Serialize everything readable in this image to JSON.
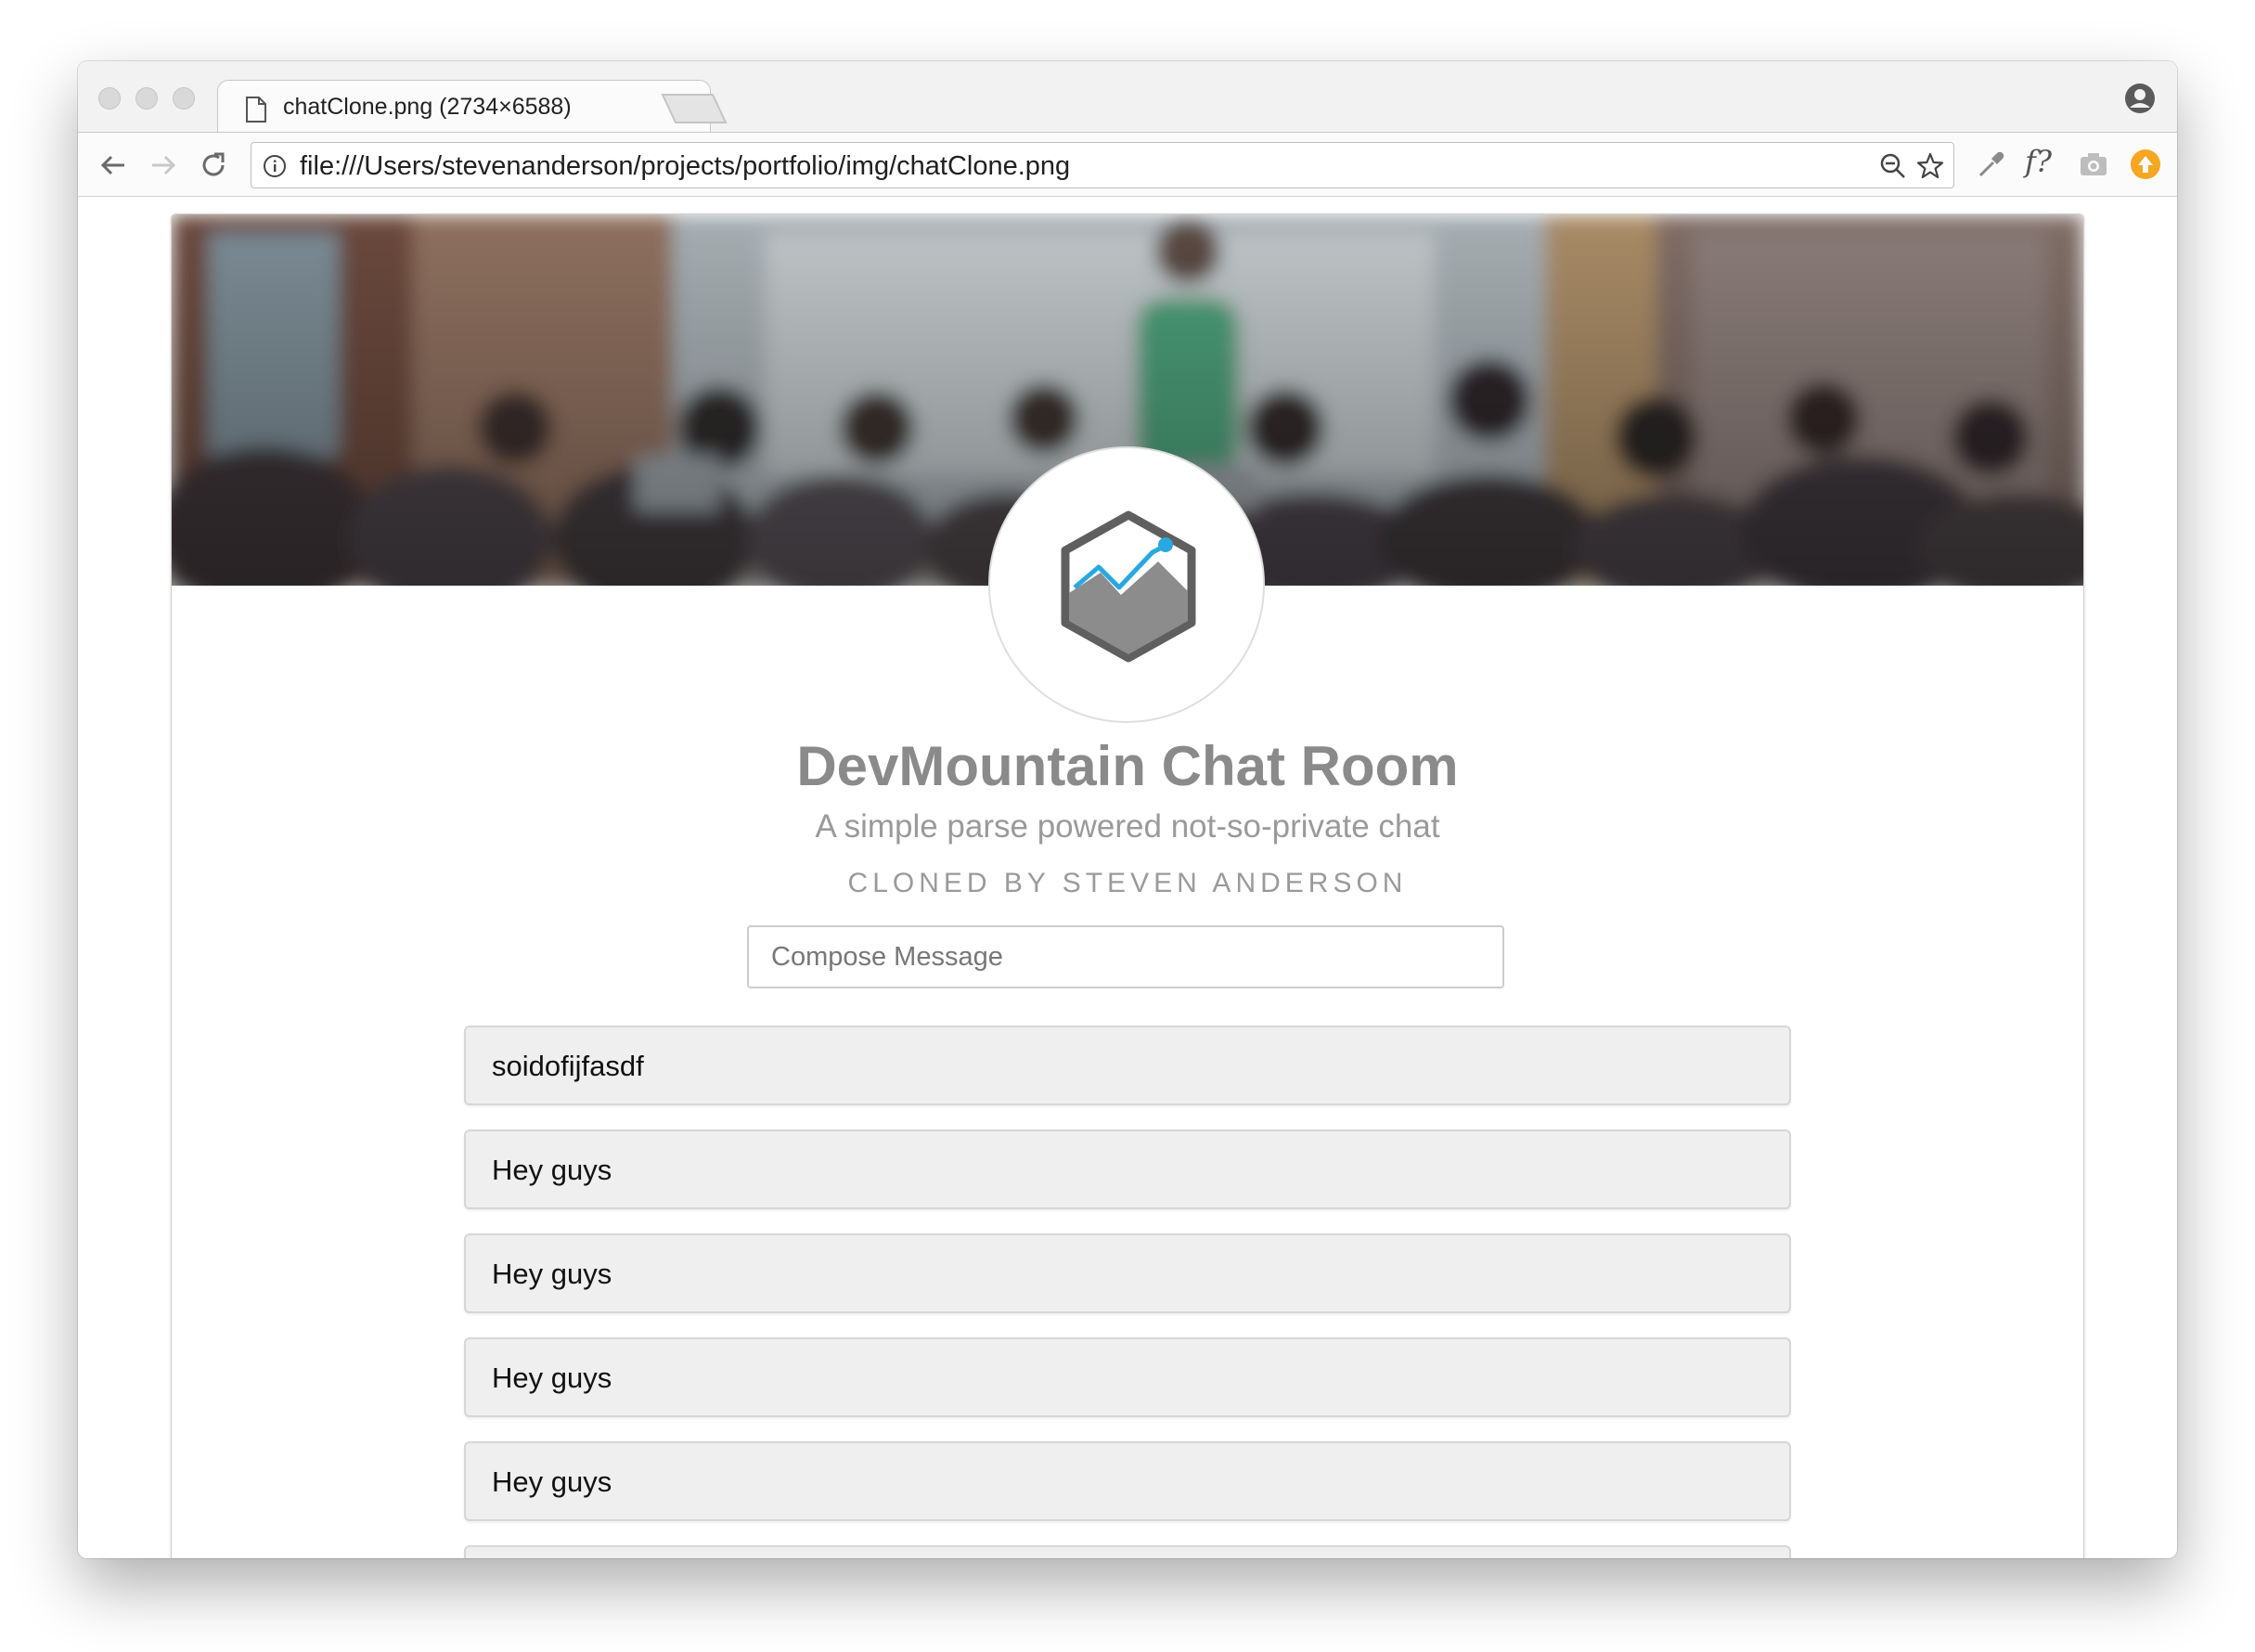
{
  "browser": {
    "tab_title": "chatClone.png (2734×6588)",
    "tab_close_glyph": "×",
    "url": "file:///Users/stevenanderson/projects/portfolio/img/chatClone.png",
    "icons": {
      "back": "back-arrow-icon",
      "forward": "forward-arrow-icon",
      "reload": "reload-icon",
      "site_info": "info-icon",
      "zoom": "zoom-out-icon",
      "bookmark": "star-icon",
      "eyedropper": "eyedropper-icon",
      "font_ext": "f?",
      "camera": "camera-icon",
      "extension_badge": "orange-extension-icon",
      "profile": "profile-icon"
    }
  },
  "page": {
    "title": "DevMountain Chat Room",
    "subtitle": "A simple parse powered not-so-private chat",
    "byline": "CLONED BY STEVEN ANDERSON",
    "compose_placeholder": "Compose Message",
    "messages": [
      "soidofijfasdf",
      "Hey guys",
      "Hey guys",
      "Hey guys",
      "Hey guys",
      ""
    ]
  },
  "colors": {
    "logo_accent": "#29a8e0",
    "logo_dark": "#5f5f5f",
    "logo_mountain": "#8c8c8c",
    "extension_orange": "#f5a623"
  }
}
